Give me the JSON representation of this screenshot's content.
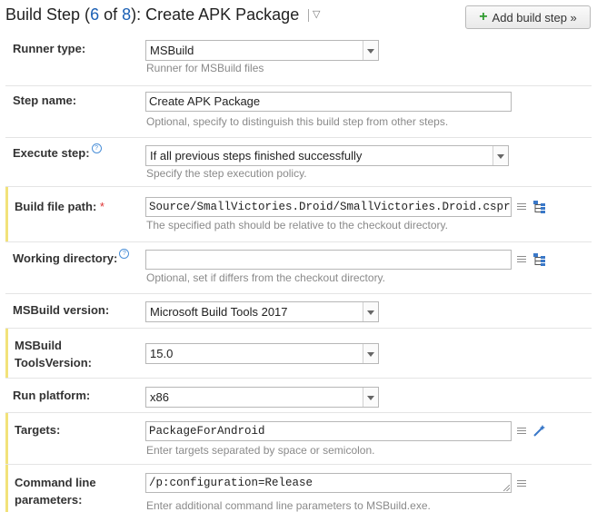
{
  "header": {
    "title_prefix": "Build Step (",
    "step_current": "6",
    "title_of": " of ",
    "step_total": "8",
    "title_suffix": "): Create APK Package",
    "menu_caret": "▽",
    "add_button": "Add build step »"
  },
  "fields": {
    "runner_type": {
      "label": "Runner type:",
      "value": "MSBuild",
      "note": "Runner for MSBuild files"
    },
    "step_name": {
      "label": "Step name:",
      "value": "Create APK Package",
      "note": "Optional, specify to distinguish this build step from other steps."
    },
    "execute_step": {
      "label": "Execute step:",
      "value": "If all previous steps finished successfully",
      "note": "Specify the step execution policy."
    },
    "build_file_path": {
      "label": "Build file path:",
      "required_mark": "*",
      "value": "Source/SmallVictories.Droid/SmallVictories.Droid.csproj",
      "note": "The specified path should be relative to the checkout directory."
    },
    "working_directory": {
      "label": "Working directory:",
      "value": "",
      "note": "Optional, set if differs from the checkout directory."
    },
    "msbuild_version": {
      "label": "MSBuild version:",
      "value": "Microsoft Build Tools 2017"
    },
    "tools_version": {
      "label_line1": "MSBuild",
      "label_line2": "ToolsVersion:",
      "value": "15.0"
    },
    "run_platform": {
      "label": "Run platform:",
      "value": "x86"
    },
    "targets": {
      "label": "Targets:",
      "value": "PackageForAndroid",
      "note": "Enter targets separated by space or semicolon."
    },
    "command_line": {
      "label_line1": "Command line",
      "label_line2": "parameters:",
      "value": "/p:configuration=Release",
      "note": "Enter additional command line parameters to MSBuild.exe."
    }
  },
  "icons": {
    "help": "?",
    "accent_required": "#f2e27a",
    "link_color": "#1a5fb4"
  }
}
